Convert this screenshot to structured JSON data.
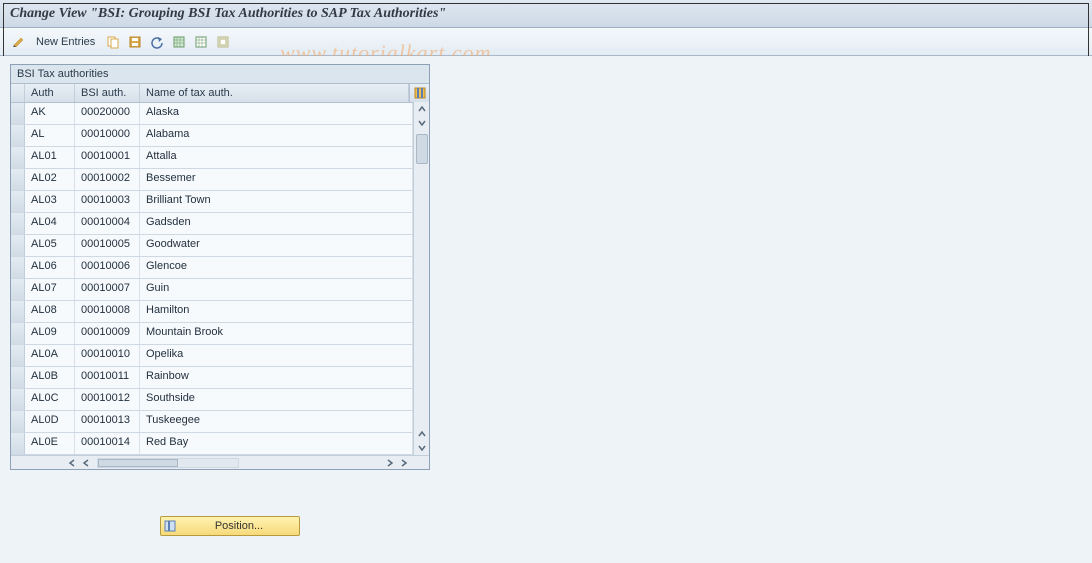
{
  "title": "Change View \"BSI: Grouping BSI Tax Authorities to SAP Tax Authorities\"",
  "watermark": "www.tutorialkart.com",
  "toolbar": {
    "new_entries_label": "New Entries"
  },
  "panel": {
    "header": "BSI Tax authorities",
    "columns": {
      "auth": "Auth",
      "bsi": "BSI auth.",
      "name": "Name of tax auth."
    }
  },
  "rows": [
    {
      "auth": "AK",
      "bsi": "00020000",
      "name": "Alaska"
    },
    {
      "auth": "AL",
      "bsi": "00010000",
      "name": "Alabama"
    },
    {
      "auth": "AL01",
      "bsi": "00010001",
      "name": "Attalla"
    },
    {
      "auth": "AL02",
      "bsi": "00010002",
      "name": "Bessemer"
    },
    {
      "auth": "AL03",
      "bsi": "00010003",
      "name": "Brilliant Town"
    },
    {
      "auth": "AL04",
      "bsi": "00010004",
      "name": "Gadsden"
    },
    {
      "auth": "AL05",
      "bsi": "00010005",
      "name": "Goodwater"
    },
    {
      "auth": "AL06",
      "bsi": "00010006",
      "name": "Glencoe"
    },
    {
      "auth": "AL07",
      "bsi": "00010007",
      "name": "Guin"
    },
    {
      "auth": "AL08",
      "bsi": "00010008",
      "name": "Hamilton"
    },
    {
      "auth": "AL09",
      "bsi": "00010009",
      "name": "Mountain Brook"
    },
    {
      "auth": "AL0A",
      "bsi": "00010010",
      "name": "Opelika"
    },
    {
      "auth": "AL0B",
      "bsi": "00010011",
      "name": "Rainbow"
    },
    {
      "auth": "AL0C",
      "bsi": "00010012",
      "name": "Southside"
    },
    {
      "auth": "AL0D",
      "bsi": "00010013",
      "name": "Tuskeegee"
    },
    {
      "auth": "AL0E",
      "bsi": "00010014",
      "name": "Red Bay"
    }
  ],
  "position_button": {
    "label": "Position..."
  }
}
